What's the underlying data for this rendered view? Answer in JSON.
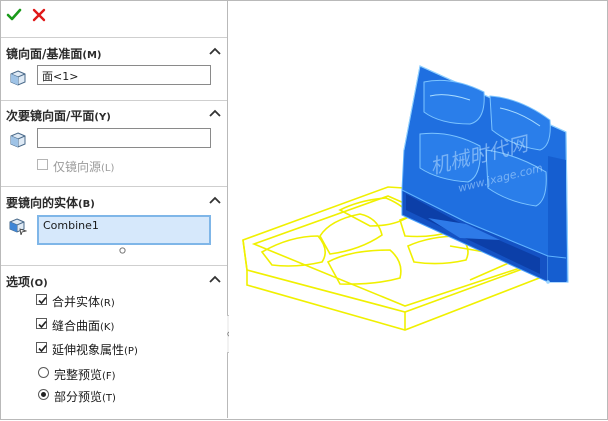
{
  "toolbar": {
    "ok_icon": "checkmark-icon",
    "cancel_icon": "close-icon"
  },
  "sections": {
    "mirror_face": {
      "title": "镜向面/基准面",
      "key": "(M)",
      "value": "面<1>"
    },
    "secondary_mirror": {
      "title": "次要镜向面/平面",
      "key": "(Y)",
      "value": "",
      "option_label": "仅镜向源",
      "option_key": "(L)"
    },
    "bodies": {
      "title": "要镜向的实体",
      "key": "(B)",
      "value": "Combine1"
    },
    "options": {
      "title": "选项",
      "key": "(O)",
      "checkboxes": [
        {
          "label": "合并实体",
          "key": "(R)",
          "checked": true
        },
        {
          "label": "缝合曲面",
          "key": "(K)",
          "checked": true
        },
        {
          "label": "延伸视象属性",
          "key": "(P)",
          "checked": true
        }
      ],
      "radios": [
        {
          "label": "完整预览",
          "key": "(F)",
          "selected": false
        },
        {
          "label": "部分预览",
          "key": "(T)",
          "selected": true
        }
      ]
    }
  },
  "watermark": {
    "line1": "机械时代网",
    "line2": "www.jxage.com"
  },
  "colors": {
    "accent": "#7fb6e8",
    "model_blue": "#1f6fe0",
    "preview_yellow": "#f0f000"
  }
}
